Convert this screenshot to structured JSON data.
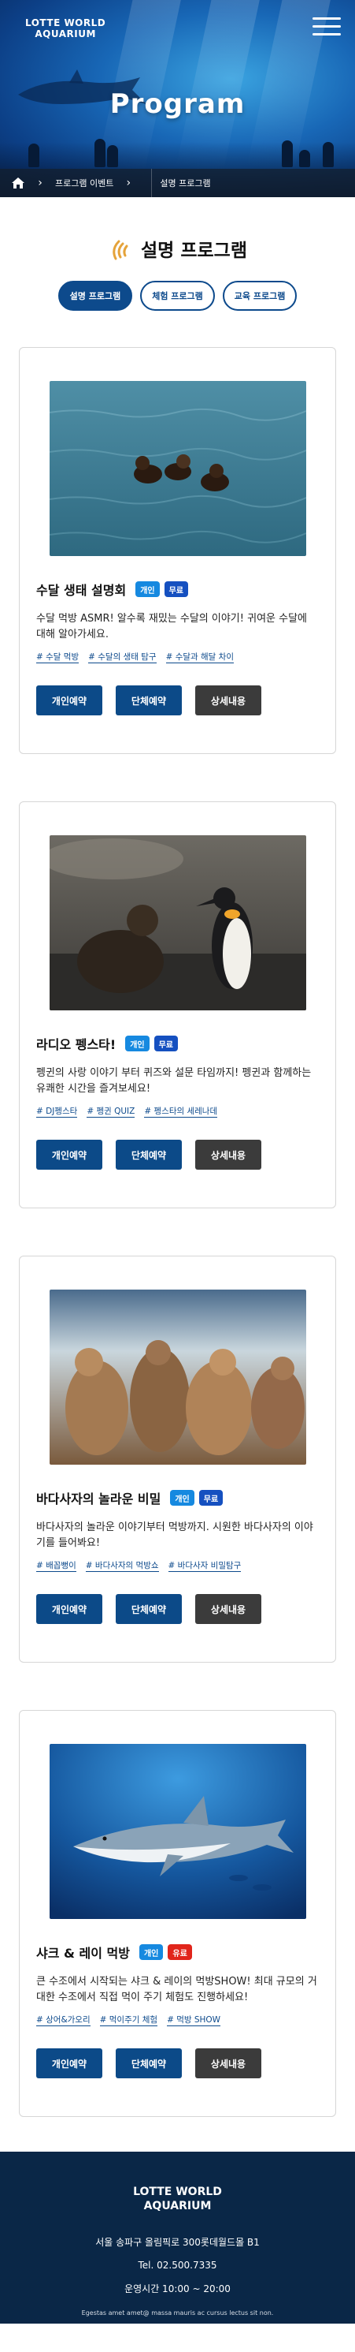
{
  "header": {
    "logo_line1": "LOTTE WORLD",
    "logo_line2": "AQUARIUM",
    "hero_title": "Program",
    "menu_icon": "hamburger-menu-icon"
  },
  "breadcrumb": {
    "home_icon": "home-icon",
    "items": [
      "프로그램 이벤트",
      "설명 프로그램"
    ]
  },
  "section": {
    "title": "설명 프로그램",
    "title_icon": "speech-wave-icon"
  },
  "tabs": [
    {
      "label": "설명 프로그램",
      "active": true
    },
    {
      "label": "체험 프로그램",
      "active": false
    },
    {
      "label": "교육 프로그램",
      "active": false
    }
  ],
  "cards": [
    {
      "title": "수달 생태 설명회",
      "badges": [
        {
          "label": "개인",
          "color": "#1689e0"
        },
        {
          "label": "무료",
          "color": "#1550c0"
        }
      ],
      "description": "수달 먹방 ASMR! 알수록 재밌는 수달의 이야기! 귀여운 수달에 대해 알아가세요.",
      "tags": [
        "# 수달 먹방",
        "# 수달의 생태 탐구",
        "# 수달과 해달 차이"
      ],
      "buttons": [
        "개인예약",
        "단체예약",
        "상세내용"
      ]
    },
    {
      "title": "라디오 펭스타!",
      "badges": [
        {
          "label": "개인",
          "color": "#1689e0"
        },
        {
          "label": "무료",
          "color": "#1550c0"
        }
      ],
      "description": "펭귄의 사랑 이야기 부터 퀴즈와 설문 타임까지! 펭귄과 함께하는 유쾌한 시간을 즐겨보세요!",
      "tags": [
        "# DJ펭스타",
        "# 펭귄 QUIZ",
        "# 펭스타의 세레나데"
      ],
      "buttons": [
        "개인예약",
        "단체예약",
        "상세내용"
      ]
    },
    {
      "title": "바다사자의 놀라운 비밀",
      "badges": [
        {
          "label": "개인",
          "color": "#1689e0"
        },
        {
          "label": "무료",
          "color": "#1550c0"
        }
      ],
      "description": "바다사자의 놀라운 이야기부터 먹방까지. 시원한 바다사자의 이야기를 들어봐요!",
      "tags": [
        "# 배꼽뻥이",
        "# 바다사자의 먹방쇼",
        "# 바다사자 비밀탐구"
      ],
      "buttons": [
        "개인예약",
        "단체예약",
        "상세내용"
      ]
    },
    {
      "title": "샤크 & 레이 먹방",
      "badges": [
        {
          "label": "개인",
          "color": "#1689e0"
        },
        {
          "label": "유료",
          "color": "#e1251b"
        }
      ],
      "description": "큰 수조에서 시작되는 샤크 & 레이의 먹방SHOW! 최대 규모의 거대한 수조에서 직접 먹이 주기 체험도 진행하세요!",
      "tags": [
        "# 상어&가오리",
        "# 먹이주기 체험",
        "# 먹방 SHOW"
      ],
      "buttons": [
        "개인예약",
        "단체예약",
        "상세내용"
      ]
    }
  ],
  "footer": {
    "logo_line1": "LOTTE WORLD",
    "logo_line2": "AQUARIUM",
    "address": "서울 송파구 올림픽로 300롯데월드몰 B1",
    "tel": "Tel. 02.500.7335",
    "hours": "운영시간 10:00 ~ 20:00",
    "copyright": "Egestas amet amet@ massa mauris ac cursus lectus sit non."
  }
}
